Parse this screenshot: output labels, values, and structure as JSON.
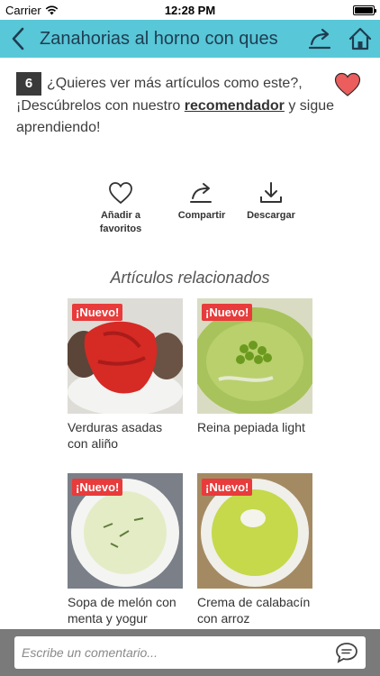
{
  "status": {
    "carrier": "Carrier",
    "time": "12:28 PM"
  },
  "nav": {
    "title": "Zanahorias al horno con ques"
  },
  "recommend": {
    "number": "6",
    "text_before": "¿Quieres ver más artículos como este?, ¡Descúbrelos con nuestro ",
    "link": "recomendador",
    "text_after": " y sigue aprendiendo!"
  },
  "actions": {
    "favorite": "Añadir a favoritos",
    "share": "Compartir",
    "download": "Descargar"
  },
  "related": {
    "title": "Artículos relacionados",
    "badge": "¡Nuevo!",
    "items": [
      {
        "label": "Verduras asadas con aliño"
      },
      {
        "label": "Reina pepiada light"
      },
      {
        "label": "Sopa de melón con menta y yogur"
      },
      {
        "label": "Crema de calabacín con arroz"
      }
    ]
  },
  "comment": {
    "placeholder": "Escribe un comentario..."
  },
  "colors": {
    "nav": "#58c7d8",
    "heart": "#ec5d5d",
    "badge_new": "#e83b3b"
  }
}
